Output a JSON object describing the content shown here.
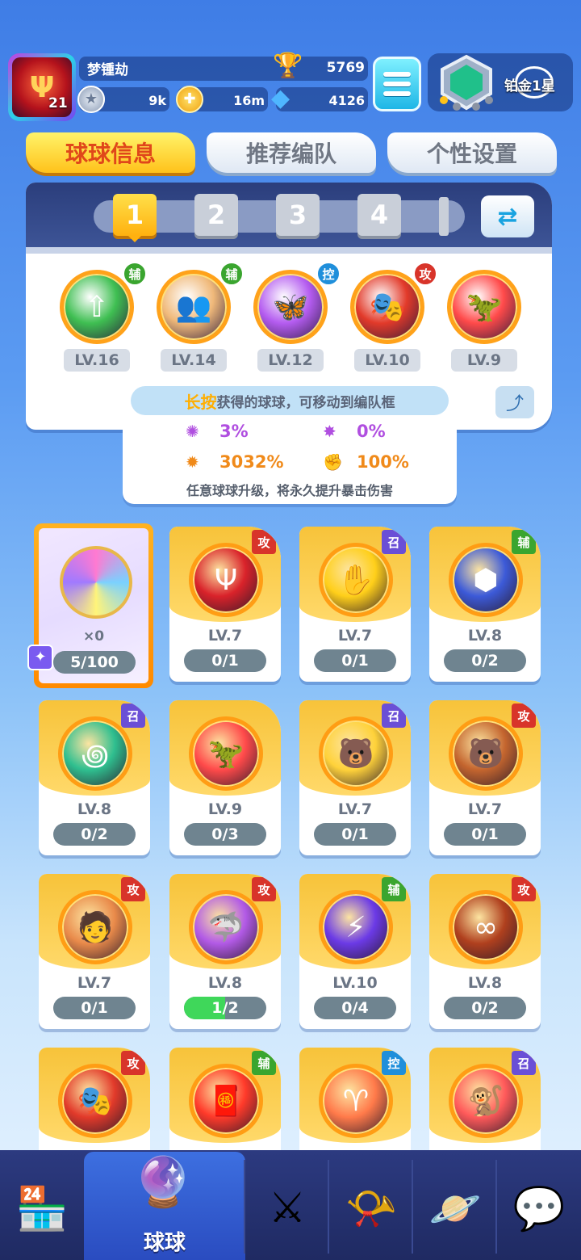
{
  "player": {
    "name": "梦锺劫",
    "level": "21",
    "trophies": "5769",
    "silver": "9k",
    "gold": "16m",
    "diamonds": "4126"
  },
  "rank": {
    "label": "铂金1星"
  },
  "tabs": [
    {
      "label": "球球信息",
      "active": true
    },
    {
      "label": "推荐编队",
      "active": false
    },
    {
      "label": "个性设置",
      "active": false
    }
  ],
  "team_slots": [
    "1",
    "2",
    "3",
    "4"
  ],
  "team": [
    {
      "level": "LV.16",
      "tag": "辅",
      "tag_color": "#3aa52f",
      "color": "#3fbf52",
      "glyph": "⇧"
    },
    {
      "level": "LV.14",
      "tag": "辅",
      "tag_color": "#3aa52f",
      "color": "#f0b97a",
      "glyph": "👥"
    },
    {
      "level": "LV.12",
      "tag": "控",
      "tag_color": "#1f8fdb",
      "color": "#b45cf0",
      "glyph": "🦋"
    },
    {
      "level": "LV.10",
      "tag": "攻",
      "tag_color": "#d8342a",
      "color": "#e23a2a",
      "glyph": "🎭"
    },
    {
      "level": "LV.9",
      "tag": "",
      "tag_color": "",
      "color": "#ff4a4a",
      "glyph": "🦖"
    }
  ],
  "hint": {
    "prefix": "长按",
    "text": "获得的球球，可移动到编队框"
  },
  "stats": {
    "a": "3%",
    "b": "0%",
    "c": "3032%",
    "d": "100%",
    "desc": "任意球球升级，将永久提升暴击伤害"
  },
  "special_card": {
    "count": "×0",
    "progress": "5/100"
  },
  "cards": [
    {
      "tag": "攻",
      "tag_color": "#d8342a",
      "level": "LV.7",
      "progress": "0/1",
      "fill": 0,
      "color": "#d9222a",
      "glyph": "Ψ"
    },
    {
      "tag": "召",
      "tag_color": "#6a4fd6",
      "level": "LV.7",
      "progress": "0/1",
      "fill": 0,
      "color": "#ffcf1a",
      "glyph": "✋"
    },
    {
      "tag": "辅",
      "tag_color": "#3aa52f",
      "level": "LV.8",
      "progress": "0/2",
      "fill": 0,
      "color": "#3c5ad8",
      "glyph": "⬢"
    },
    {
      "tag": "召",
      "tag_color": "#6a4fd6",
      "level": "LV.8",
      "progress": "0/2",
      "fill": 0,
      "color": "#2fbf8f",
      "glyph": "꩜"
    },
    {
      "tag": "",
      "tag_color": "",
      "level": "LV.9",
      "progress": "0/3",
      "fill": 0,
      "color": "#ff4a4a",
      "glyph": "🦖"
    },
    {
      "tag": "召",
      "tag_color": "#6a4fd6",
      "level": "LV.7",
      "progress": "0/1",
      "fill": 0,
      "color": "#ffd23a",
      "glyph": "🐻"
    },
    {
      "tag": "攻",
      "tag_color": "#d8342a",
      "level": "LV.7",
      "progress": "0/1",
      "fill": 0,
      "color": "#c4652e",
      "glyph": "🐻"
    },
    {
      "tag": "攻",
      "tag_color": "#d8342a",
      "level": "LV.7",
      "progress": "0/1",
      "fill": 0,
      "color": "#e98a4a",
      "glyph": "🧑"
    },
    {
      "tag": "攻",
      "tag_color": "#d8342a",
      "level": "LV.8",
      "progress": "1/2",
      "fill": 0.5,
      "color": "#b25ae6",
      "glyph": "🦈"
    },
    {
      "tag": "辅",
      "tag_color": "#3aa52f",
      "level": "LV.10",
      "progress": "0/4",
      "fill": 0,
      "color": "#6b3ae6",
      "glyph": "⚡"
    },
    {
      "tag": "攻",
      "tag_color": "#d8342a",
      "level": "LV.8",
      "progress": "0/2",
      "fill": 0,
      "color": "#b0401e",
      "glyph": "∞"
    },
    {
      "tag": "攻",
      "tag_color": "#d8342a",
      "level": "",
      "progress": "",
      "fill": 0,
      "color": "#e23a2a",
      "glyph": "🎭"
    },
    {
      "tag": "辅",
      "tag_color": "#3aa52f",
      "level": "",
      "progress": "",
      "fill": 0,
      "color": "#ff3a2a",
      "glyph": "🧧"
    },
    {
      "tag": "控",
      "tag_color": "#1f8fdb",
      "level": "",
      "progress": "",
      "fill": 0,
      "color": "#ff7a4a",
      "glyph": "♈"
    },
    {
      "tag": "召",
      "tag_color": "#6a4fd6",
      "level": "",
      "progress": "",
      "fill": 0,
      "color": "#ff5a5a",
      "glyph": "🐒"
    }
  ],
  "nav": [
    {
      "name": "shop-icon",
      "glyph": "🏪"
    },
    {
      "name": "balls-icon",
      "glyph": "🔮",
      "label": "球球",
      "active": true
    },
    {
      "name": "battle-icon",
      "glyph": "⚔"
    },
    {
      "name": "whistle-icon",
      "glyph": "📯"
    },
    {
      "name": "planet-icon",
      "glyph": "🪐"
    },
    {
      "name": "social-icon",
      "glyph": "💬"
    }
  ]
}
